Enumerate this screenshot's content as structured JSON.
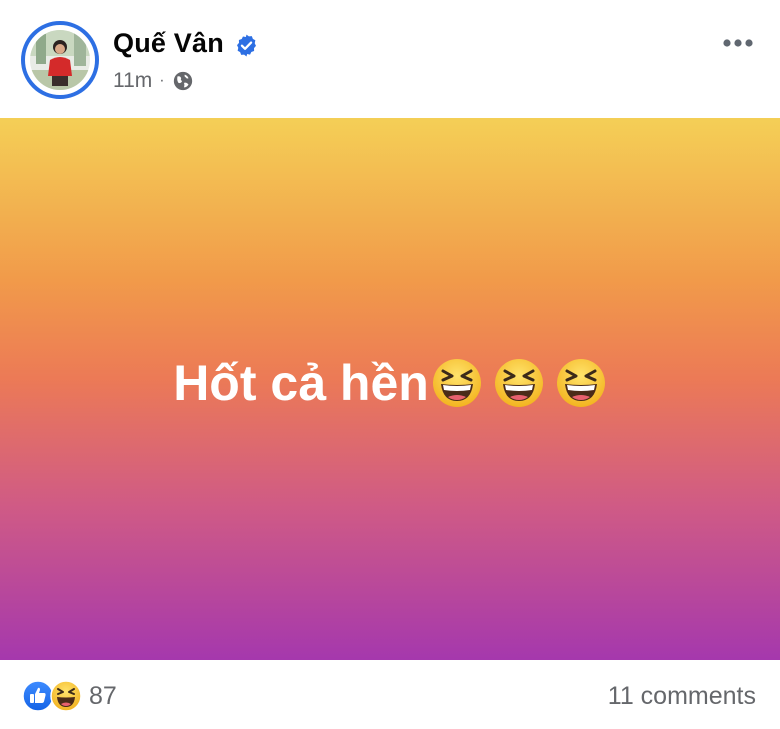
{
  "post": {
    "author": "Quế Vân",
    "time": "11m",
    "separator": "·",
    "text": "Hốt cả hền",
    "emoji_icons": [
      "grinning-squinting-face-icon",
      "grinning-squinting-face-icon",
      "grinning-squinting-face-icon"
    ],
    "background_colors": [
      "#f4cf56",
      "#f19a4a",
      "#ec7a56",
      "#cf5a86",
      "#a538ad"
    ]
  },
  "footer": {
    "reaction_icons": [
      "like-icon",
      "haha-icon"
    ],
    "reaction_count": "87",
    "comments": "11 comments"
  },
  "colors": {
    "accent": "#2d6fe3",
    "text_primary": "#050505",
    "text_secondary": "#65676b"
  }
}
